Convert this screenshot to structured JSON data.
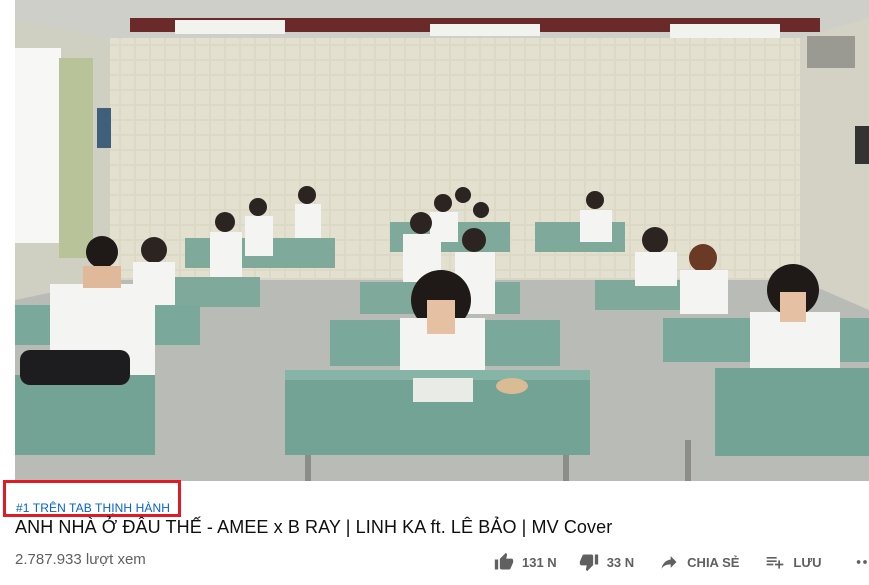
{
  "video": {
    "description_alt": "Classroom scene with students in white shirts sitting at green desks",
    "colors": {
      "wall": "#d7d3bf",
      "desk": "#7aa89a",
      "floor": "#bfc1bb"
    }
  },
  "trending_tag": "#1 TRÊN TAB THỊNH HÀNH",
  "title": "ANH NHÀ Ở ĐÂU THẾ - AMEE x B RAY | LINH KA ft. LÊ BẢO | MV Cover",
  "views": "2.787.933 lượt xem",
  "actions": {
    "like": {
      "icon": "thumb-up-icon",
      "label": "131 N"
    },
    "dislike": {
      "icon": "thumb-down-icon",
      "label": "33 N"
    },
    "share": {
      "icon": "share-icon",
      "label": "CHIA SẺ"
    },
    "save": {
      "icon": "playlist-add-icon",
      "label": "LƯU"
    },
    "more": {
      "icon": "more-horiz-icon"
    }
  },
  "accent_colors": {
    "trend_link": "#065fd4",
    "highlight_box": "#e01b24",
    "meta_text": "#606060"
  }
}
